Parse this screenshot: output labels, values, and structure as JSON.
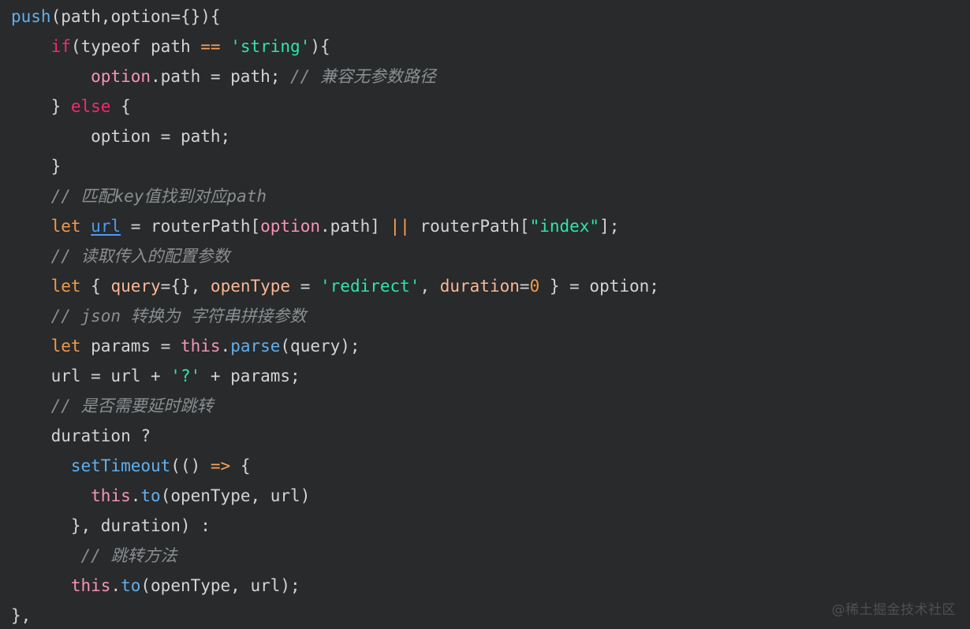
{
  "editor": {
    "language": "javascript",
    "theme": "dark",
    "background_color": "#282a2b",
    "watermark": "@稀土掘金技术社区",
    "lines": [
      {
        "n": 1,
        "indent": 0,
        "tokens": [
          {
            "t": "push",
            "c": "func"
          },
          {
            "t": "(",
            "c": "punct"
          },
          {
            "t": "path,option",
            "c": "plain"
          },
          {
            "t": "=",
            "c": "plain"
          },
          {
            "t": "{}",
            "c": "punct"
          },
          {
            "t": ")",
            "c": "punct"
          },
          {
            "t": "{",
            "c": "punct"
          }
        ]
      },
      {
        "n": 2,
        "indent": 4,
        "tokens": [
          {
            "t": "if",
            "c": "keyword"
          },
          {
            "t": "(",
            "c": "punct"
          },
          {
            "t": "typeof path ",
            "c": "plain"
          },
          {
            "t": "==",
            "c": "op"
          },
          {
            "t": " ",
            "c": "plain"
          },
          {
            "t": "'string'",
            "c": "string"
          },
          {
            "t": ")",
            "c": "punct"
          },
          {
            "t": "{",
            "c": "punct"
          }
        ]
      },
      {
        "n": 3,
        "indent": 8,
        "tokens": [
          {
            "t": "option",
            "c": "prop"
          },
          {
            "t": ".path = path; ",
            "c": "plain"
          },
          {
            "t": "// 兼容无参数路径",
            "c": "comment"
          }
        ]
      },
      {
        "n": 4,
        "indent": 4,
        "tokens": [
          {
            "t": "} ",
            "c": "punct"
          },
          {
            "t": "else",
            "c": "keyword"
          },
          {
            "t": " {",
            "c": "punct"
          }
        ]
      },
      {
        "n": 5,
        "indent": 8,
        "tokens": [
          {
            "t": "option = path;",
            "c": "plain"
          }
        ]
      },
      {
        "n": 6,
        "indent": 4,
        "tokens": [
          {
            "t": "}",
            "c": "punct"
          }
        ]
      },
      {
        "n": 7,
        "indent": 4,
        "tokens": [
          {
            "t": "// 匹配key值找到对应path",
            "c": "comment"
          }
        ]
      },
      {
        "n": 8,
        "indent": 4,
        "tokens": [
          {
            "t": "let",
            "c": "let"
          },
          {
            "t": " ",
            "c": "plain"
          },
          {
            "t": "url",
            "c": "link"
          },
          {
            "t": " = routerPath",
            "c": "plain"
          },
          {
            "t": "[",
            "c": "punct"
          },
          {
            "t": "option",
            "c": "prop"
          },
          {
            "t": ".path",
            "c": "plain"
          },
          {
            "t": "]",
            "c": "punct"
          },
          {
            "t": " ",
            "c": "plain"
          },
          {
            "t": "||",
            "c": "op"
          },
          {
            "t": " routerPath",
            "c": "plain"
          },
          {
            "t": "[",
            "c": "punct"
          },
          {
            "t": "\"index\"",
            "c": "string"
          },
          {
            "t": "]",
            "c": "punct"
          },
          {
            "t": ";",
            "c": "plain"
          }
        ]
      },
      {
        "n": 9,
        "indent": 4,
        "tokens": [
          {
            "t": "// 读取传入的配置参数",
            "c": "comment"
          }
        ]
      },
      {
        "n": 10,
        "indent": 4,
        "tokens": [
          {
            "t": "let",
            "c": "let"
          },
          {
            "t": " { ",
            "c": "punct"
          },
          {
            "t": "query",
            "c": "var"
          },
          {
            "t": "=",
            "c": "plain"
          },
          {
            "t": "{}",
            "c": "punct"
          },
          {
            "t": ", ",
            "c": "plain"
          },
          {
            "t": "openType",
            "c": "var"
          },
          {
            "t": " = ",
            "c": "plain"
          },
          {
            "t": "'redirect'",
            "c": "string"
          },
          {
            "t": ", ",
            "c": "plain"
          },
          {
            "t": "duration",
            "c": "var"
          },
          {
            "t": "=",
            "c": "plain"
          },
          {
            "t": "0",
            "c": "num"
          },
          {
            "t": " } = option;",
            "c": "plain"
          }
        ]
      },
      {
        "n": 11,
        "indent": 4,
        "tokens": [
          {
            "t": "// json 转换为 字符串拼接参数",
            "c": "comment"
          }
        ]
      },
      {
        "n": 12,
        "indent": 4,
        "tokens": [
          {
            "t": "let",
            "c": "let"
          },
          {
            "t": " params = ",
            "c": "plain"
          },
          {
            "t": "this",
            "c": "this"
          },
          {
            "t": ".",
            "c": "plain"
          },
          {
            "t": "parse",
            "c": "method"
          },
          {
            "t": "(query);",
            "c": "plain"
          }
        ]
      },
      {
        "n": 13,
        "indent": 4,
        "tokens": [
          {
            "t": "url = url + ",
            "c": "plain"
          },
          {
            "t": "'?'",
            "c": "string"
          },
          {
            "t": " + params;",
            "c": "plain"
          }
        ]
      },
      {
        "n": 14,
        "indent": 4,
        "tokens": [
          {
            "t": "// 是否需要延时跳转",
            "c": "comment"
          }
        ]
      },
      {
        "n": 15,
        "indent": 4,
        "tokens": [
          {
            "t": "duration ?",
            "c": "plain"
          }
        ]
      },
      {
        "n": 16,
        "indent": 6,
        "tokens": [
          {
            "t": "setTimeout",
            "c": "method"
          },
          {
            "t": "(() ",
            "c": "punct"
          },
          {
            "t": "=>",
            "c": "op"
          },
          {
            "t": " {",
            "c": "punct"
          }
        ]
      },
      {
        "n": 17,
        "indent": 8,
        "tokens": [
          {
            "t": "this",
            "c": "this"
          },
          {
            "t": ".",
            "c": "plain"
          },
          {
            "t": "to",
            "c": "method"
          },
          {
            "t": "(openType, url)",
            "c": "plain"
          }
        ]
      },
      {
        "n": 18,
        "indent": 6,
        "tokens": [
          {
            "t": "}, duration) :",
            "c": "plain"
          }
        ]
      },
      {
        "n": 19,
        "indent": 7,
        "tokens": [
          {
            "t": "// 跳转方法",
            "c": "comment"
          }
        ]
      },
      {
        "n": 20,
        "indent": 6,
        "tokens": [
          {
            "t": "this",
            "c": "this"
          },
          {
            "t": ".",
            "c": "plain"
          },
          {
            "t": "to",
            "c": "method"
          },
          {
            "t": "(openType, url);",
            "c": "plain"
          }
        ]
      },
      {
        "n": 21,
        "indent": 0,
        "tokens": [
          {
            "t": "},",
            "c": "punct"
          }
        ]
      }
    ]
  }
}
